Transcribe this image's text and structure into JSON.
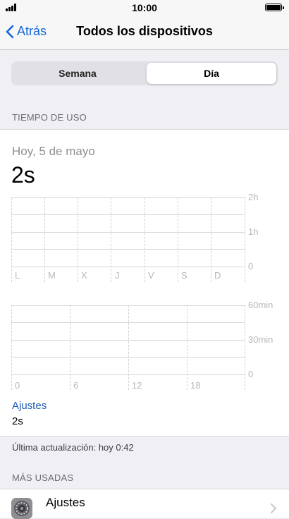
{
  "status": {
    "time": "10:00"
  },
  "nav": {
    "back_label": "Atrás",
    "title": "Todos los dispositivos"
  },
  "segments": {
    "week": "Semana",
    "day": "Día",
    "selected": "day"
  },
  "usage": {
    "header": "TIEMPO DE USO",
    "date": "Hoy, 5 de mayo",
    "total": "2s",
    "weekly_chart": {
      "y_labels": [
        "2h",
        "1h",
        "0"
      ],
      "x_labels": [
        "L",
        "M",
        "X",
        "J",
        "V",
        "S",
        "D"
      ]
    },
    "hourly_chart": {
      "y_labels": [
        "60min",
        "30min",
        "0"
      ],
      "x_labels": [
        "0",
        "6",
        "12",
        "18"
      ]
    },
    "app_link": "Ajustes",
    "app_time": "2s"
  },
  "last_update": "Última actualización: hoy 0:42",
  "most_used": {
    "header": "MÁS USADAS",
    "items": [
      {
        "name": "Ajustes"
      }
    ]
  },
  "colors": {
    "accent": "#1468d8",
    "link": "#1f5bb5",
    "background": "#efeff4"
  }
}
